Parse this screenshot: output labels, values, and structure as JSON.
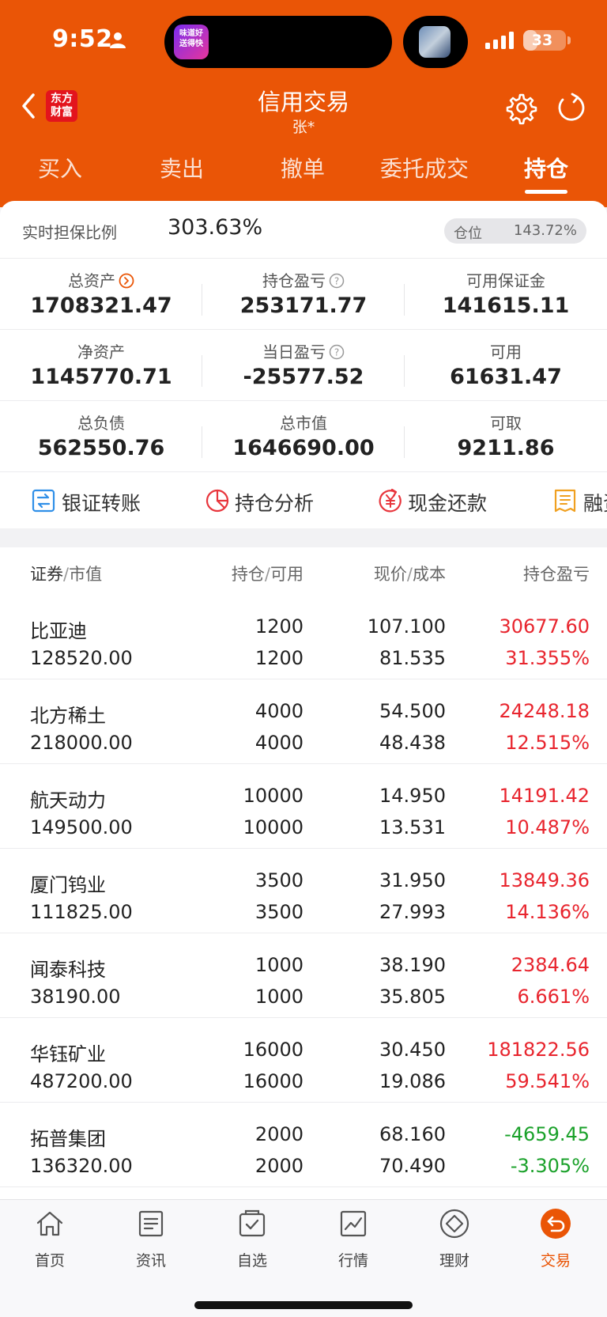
{
  "status_bar": {
    "time": "9:52",
    "battery": "33",
    "battery_pct": 33,
    "island_app_text": "味道好送得快"
  },
  "header": {
    "title": "信用交易",
    "subtitle": "张*",
    "logo_text": "东方财富"
  },
  "tabs": [
    {
      "label": "买入",
      "active": false
    },
    {
      "label": "卖出",
      "active": false
    },
    {
      "label": "撤单",
      "active": false
    },
    {
      "label": "委托成交",
      "active": false
    },
    {
      "label": "持仓",
      "active": true
    }
  ],
  "summary": {
    "guarantee_ratio_label": "实时担保比例",
    "guarantee_ratio_value": "303.63%",
    "position_label": "仓位",
    "position_value": "143.72%",
    "metrics": [
      [
        {
          "label": "总资产",
          "value": "1708321.47",
          "tone": "neutral"
        },
        {
          "label": "持仓盈亏",
          "value": "253171.77",
          "tone": "up"
        },
        {
          "label": "可用保证金",
          "value": "141615.11",
          "tone": "neutral"
        }
      ],
      [
        {
          "label": "净资产",
          "value": "1145770.71",
          "tone": "neutral"
        },
        {
          "label": "当日盈亏",
          "value": "-25577.52",
          "tone": "down"
        },
        {
          "label": "可用",
          "value": "61631.47",
          "tone": "neutral"
        }
      ],
      [
        {
          "label": "总负债",
          "value": "562550.76",
          "tone": "neutral"
        },
        {
          "label": "总市值",
          "value": "1646690.00",
          "tone": "neutral"
        },
        {
          "label": "可取",
          "value": "9211.86",
          "tone": "neutral"
        }
      ]
    ]
  },
  "tools": [
    {
      "label": "银证转账",
      "icon": "transfer-icon"
    },
    {
      "label": "持仓分析",
      "icon": "pie-chart-icon"
    },
    {
      "label": "现金还款",
      "icon": "yuan-repay-icon"
    },
    {
      "label": "融资",
      "icon": "document-icon"
    }
  ],
  "table": {
    "headers": {
      "col1_a": "证券",
      "col1_b": "市值",
      "col2_a": "持仓",
      "col2_b": "可用",
      "col3_a": "现价",
      "col3_b": "成本",
      "col4": "持仓盈亏"
    },
    "rows": [
      {
        "name": "比亚迪",
        "market_value": "128520.00",
        "qty": "1200",
        "available": "1200",
        "price": "107.100",
        "cost": "81.535",
        "pl": "30677.60",
        "pl_pct": "31.355%",
        "tone": "up"
      },
      {
        "name": "北方稀土",
        "market_value": "218000.00",
        "qty": "4000",
        "available": "4000",
        "price": "54.500",
        "cost": "48.438",
        "pl": "24248.18",
        "pl_pct": "12.515%",
        "tone": "up"
      },
      {
        "name": "航天动力",
        "market_value": "149500.00",
        "qty": "10000",
        "available": "10000",
        "price": "14.950",
        "cost": "13.531",
        "pl": "14191.42",
        "pl_pct": "10.487%",
        "tone": "up"
      },
      {
        "name": "厦门钨业",
        "market_value": "111825.00",
        "qty": "3500",
        "available": "3500",
        "price": "31.950",
        "cost": "27.993",
        "pl": "13849.36",
        "pl_pct": "14.136%",
        "tone": "up"
      },
      {
        "name": "闻泰科技",
        "market_value": "38190.00",
        "qty": "1000",
        "available": "1000",
        "price": "38.190",
        "cost": "35.805",
        "pl": "2384.64",
        "pl_pct": "6.661%",
        "tone": "up"
      },
      {
        "name": "华钰矿业",
        "market_value": "487200.00",
        "qty": "16000",
        "available": "16000",
        "price": "30.450",
        "cost": "19.086",
        "pl": "181822.56",
        "pl_pct": "59.541%",
        "tone": "up"
      },
      {
        "name": "拓普集团",
        "market_value": "136320.00",
        "qty": "2000",
        "available": "2000",
        "price": "68.160",
        "cost": "70.490",
        "pl": "-4659.45",
        "pl_pct": "-3.305%",
        "tone": "down"
      }
    ]
  },
  "bottom_nav": [
    {
      "label": "首页",
      "icon": "home-icon",
      "active": false
    },
    {
      "label": "资讯",
      "icon": "news-icon",
      "active": false
    },
    {
      "label": "自选",
      "icon": "watchlist-icon",
      "active": false
    },
    {
      "label": "行情",
      "icon": "market-chart-icon",
      "active": false
    },
    {
      "label": "理财",
      "icon": "wealth-diamond-icon",
      "active": false
    },
    {
      "label": "交易",
      "icon": "trade-icon",
      "active": true
    }
  ],
  "colors": {
    "brand": "#ea5506",
    "up": "#e8252e",
    "down": "#1aa12a",
    "logo": "#e3141d"
  }
}
